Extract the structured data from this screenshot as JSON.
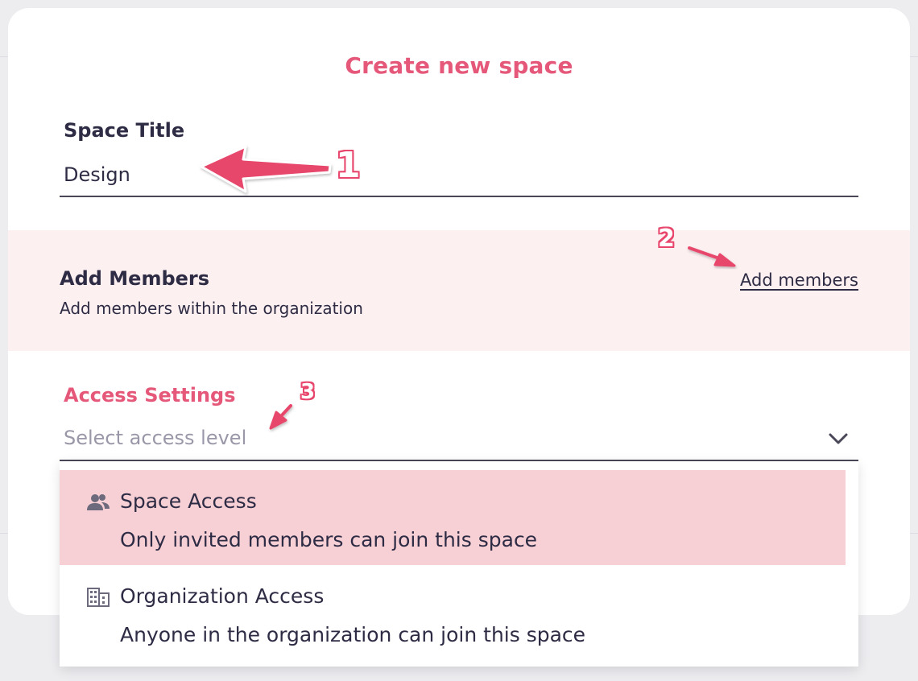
{
  "modal": {
    "title": "Create new space"
  },
  "space_title": {
    "label": "Space Title",
    "value": "Design"
  },
  "members": {
    "title": "Add Members",
    "subtitle": "Add members within the organization",
    "link_label": "Add members"
  },
  "access": {
    "label": "Access Settings",
    "placeholder": "Select access level",
    "options": [
      {
        "icon": "people-icon",
        "title": "Space Access",
        "description": "Only invited members can join this space",
        "selected": true
      },
      {
        "icon": "building-icon",
        "title": "Organization Access",
        "description": "Anyone in the organization can join this space",
        "selected": false
      }
    ]
  },
  "annotations": {
    "marker_1": "1",
    "marker_2": "2",
    "marker_3": "3"
  },
  "colors": {
    "accent": "#e5587a",
    "annotation": "#e8466c",
    "band": "#fdf0f1",
    "selected_option": "#f7d0d6",
    "text": "#2e2c44",
    "placeholder": "#9a98a8"
  }
}
